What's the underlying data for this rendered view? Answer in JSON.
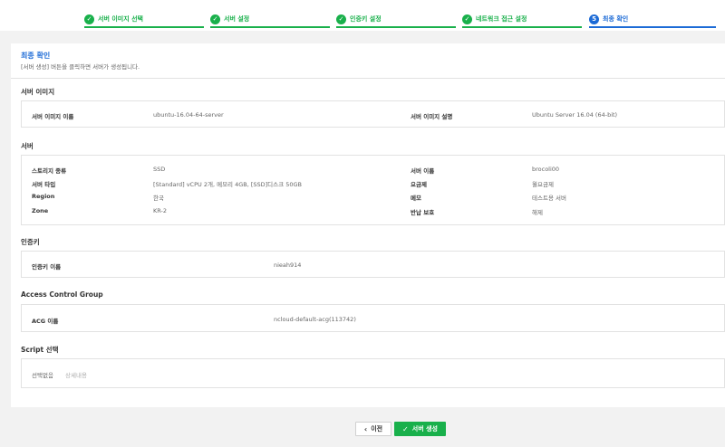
{
  "stepper": {
    "steps": [
      {
        "num": "✓",
        "label": "서버 이미지 선택"
      },
      {
        "num": "✓",
        "label": "서버 설정"
      },
      {
        "num": "✓",
        "label": "인증키 설정"
      },
      {
        "num": "✓",
        "label": "네트워크 접근 설정"
      },
      {
        "num": "5",
        "label": "최종 확인"
      }
    ]
  },
  "header": {
    "title": "최종 확인",
    "desc": "[서버 생성] 버튼을 클릭하면 서버가 생성됩니다."
  },
  "server_image": {
    "title": "서버 이미지",
    "name_key": "서버 이미지 이름",
    "name_val": "ubuntu-16.04-64-server",
    "desc_key": "서버 이미지 설명",
    "desc_val": "Ubuntu Server 16.04 (64-bit)"
  },
  "server": {
    "title": "서버",
    "storage_key": "스토리지 종류",
    "storage_val": "SSD",
    "type_key": "서버 타입",
    "type_val": "[Standard] vCPU 2개, 메모리 4GB, [SSD]디스크 50GB",
    "region_key": "Region",
    "region_val": "한국",
    "zone_key": "Zone",
    "zone_val": "KR-2",
    "name_key": "서버 이름",
    "name_val": "brocoli00",
    "plan_key": "요금제",
    "plan_val": "월요금제",
    "memo_key": "메모",
    "memo_val": "테스트용 서버",
    "protect_key": "반납 보호",
    "protect_val": "해제"
  },
  "auth": {
    "title": "인증키",
    "key": "인증키 이름",
    "val": "nieah914"
  },
  "acg": {
    "title": "Access Control Group",
    "key": "ACG 이름",
    "val": "ncloud-default-acg(113742)"
  },
  "script": {
    "title": "Script 선택",
    "key": "선택없음",
    "val": "상세내용"
  },
  "footer": {
    "prev_label": "이전",
    "create_label": "서버 생성"
  },
  "colors": {
    "accent_green": "#19b04b",
    "accent_blue": "#1d6bd6"
  }
}
